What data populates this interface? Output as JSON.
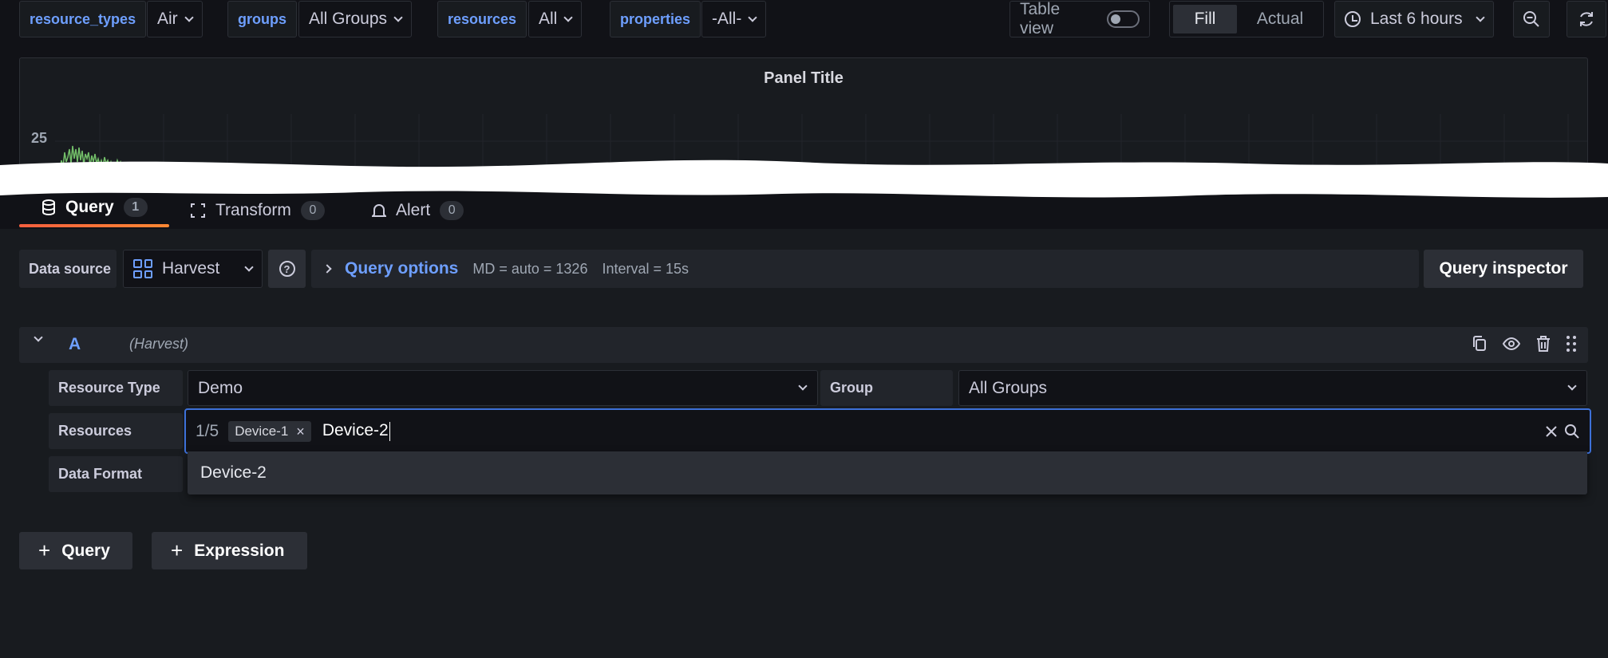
{
  "variables": [
    {
      "label": "resource_types",
      "value": "Air"
    },
    {
      "label": "groups",
      "value": "All Groups"
    },
    {
      "label": "resources",
      "value": "All"
    },
    {
      "label": "properties",
      "value": "-All-"
    }
  ],
  "toolbar": {
    "table_view_label": "Table view",
    "table_view_on": false,
    "fill_label": "Fill",
    "actual_label": "Actual",
    "time_range": "Last 6 hours"
  },
  "panel": {
    "title": "Panel Title",
    "y_tick": "25"
  },
  "tabs": [
    {
      "label": "Query",
      "count": "1",
      "active": true
    },
    {
      "label": "Transform",
      "count": "0",
      "active": false
    },
    {
      "label": "Alert",
      "count": "0",
      "active": false
    }
  ],
  "datasource": {
    "label": "Data source",
    "value": "Harvest"
  },
  "query_options": {
    "title": "Query options",
    "md": "MD = auto = 1326",
    "interval": "Interval = 15s"
  },
  "query_inspector_label": "Query inspector",
  "query_row": {
    "letter": "A",
    "datasource": "(Harvest)"
  },
  "fields": {
    "resource_type_label": "Resource Type",
    "resource_type_value": "Demo",
    "group_label": "Group",
    "group_value": "All Groups",
    "resources_label": "Resources",
    "data_format_label": "Data Format"
  },
  "resources_input": {
    "count": "1/5",
    "chips": [
      "Device-1"
    ],
    "typed": "Device-2"
  },
  "dropdown_options": [
    "Device-2"
  ],
  "add_query_label": "Query",
  "add_expression_label": "Expression",
  "colors": {
    "accent_blue": "#6e9fff",
    "focus_border": "#3d71d9",
    "tab_underline": "#f55f3e",
    "series_green": "#73bf69"
  }
}
